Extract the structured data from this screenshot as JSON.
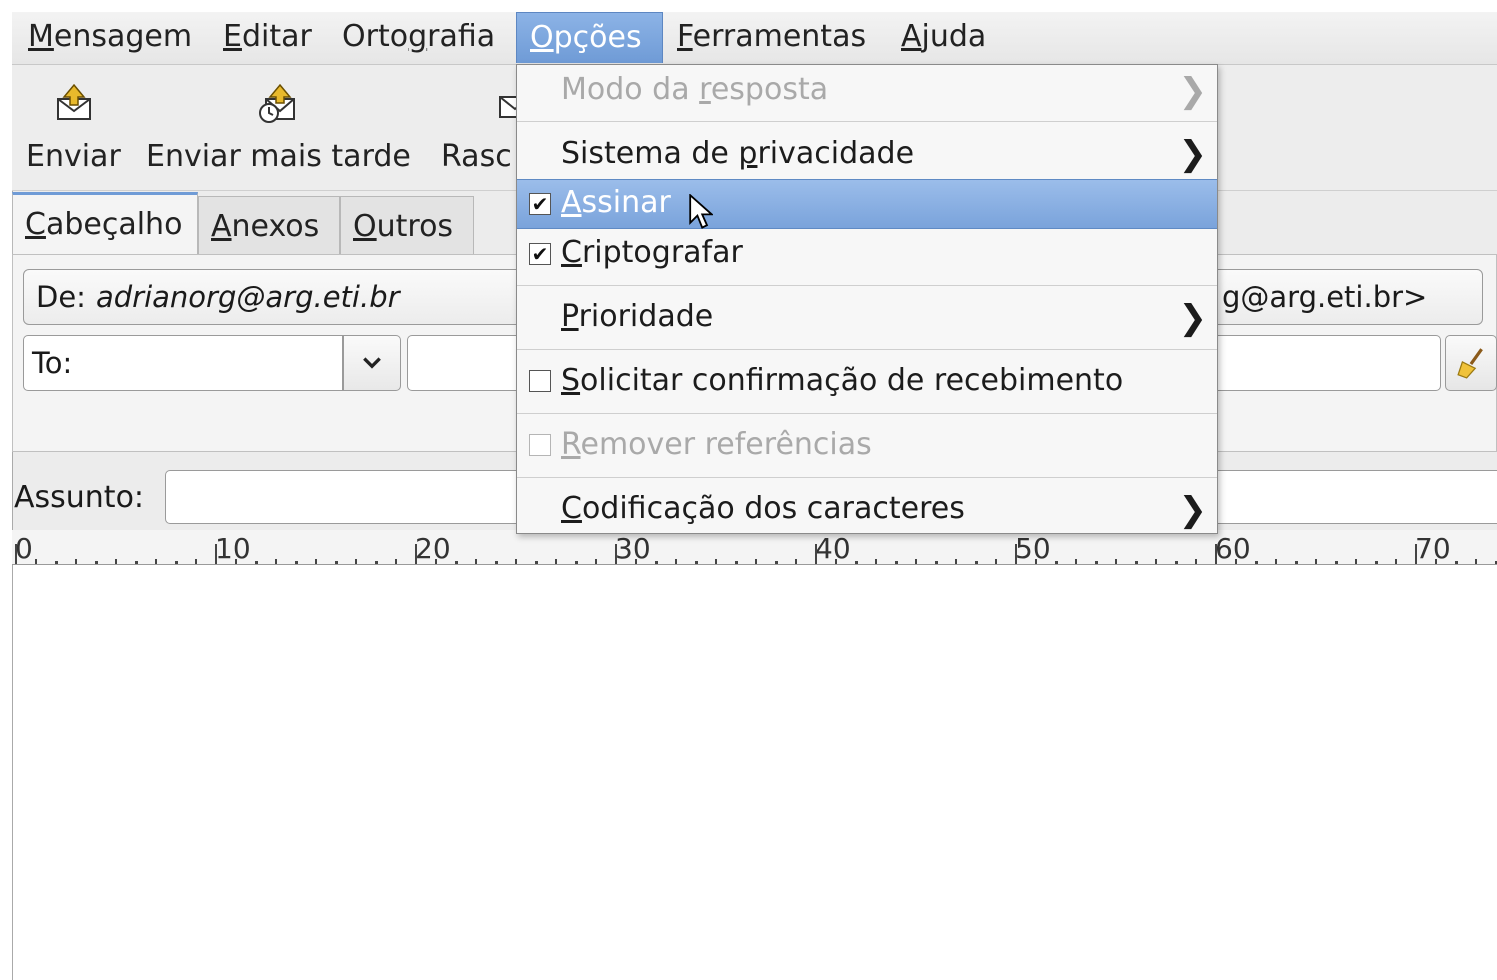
{
  "menubar": {
    "items": [
      {
        "pre": "",
        "u": "M",
        "post": "ensagem"
      },
      {
        "pre": "",
        "u": "E",
        "post": "ditar"
      },
      {
        "pre": "Orto",
        "u": "g",
        "post": "rafia"
      },
      {
        "pre": "",
        "u": "O",
        "post": "pções"
      },
      {
        "pre": "",
        "u": "F",
        "post": "erramentas"
      },
      {
        "pre": "",
        "u": "A",
        "post": "juda"
      }
    ]
  },
  "toolbar": {
    "send_label": "Enviar",
    "send_later_label": "Enviar mais tarde",
    "draft_label": "Rasc"
  },
  "tabs": [
    {
      "pre": "",
      "u": "C",
      "post": "abeçalho"
    },
    {
      "pre": "",
      "u": "A",
      "post": "nexos"
    },
    {
      "pre": "",
      "u": "O",
      "post": "utros"
    }
  ],
  "header": {
    "from_label": "De:",
    "from_value": "adrianorg@arg.eti.br",
    "from_tail": "g@arg.eti.br>",
    "to_label": "To:",
    "to_value": "",
    "subject_label": "Assunto:",
    "subject_value": ""
  },
  "ruler": {
    "labels": [
      "0",
      "10",
      "20",
      "30",
      "40",
      "50",
      "60",
      "70"
    ]
  },
  "options_menu": {
    "items": [
      {
        "pre": "Modo da ",
        "u": "r",
        "post": "esposta",
        "state": "disabled",
        "submenu": true,
        "check": null
      },
      {
        "pre": "Sistema de ",
        "u": "p",
        "post": "rivacidade",
        "state": "normal",
        "submenu": true,
        "check": null
      },
      {
        "pre": "",
        "u": "A",
        "post": "ssinar",
        "state": "highlight",
        "submenu": false,
        "check": true
      },
      {
        "pre": "",
        "u": "C",
        "post": "riptografar",
        "state": "normal",
        "submenu": false,
        "check": true
      },
      {
        "pre": "",
        "u": "P",
        "post": "rioridade",
        "state": "normal",
        "submenu": true,
        "check": null
      },
      {
        "pre": "",
        "u": "S",
        "post": "olicitar confirmação de recebimento",
        "state": "normal",
        "submenu": false,
        "check": false
      },
      {
        "pre": "",
        "u": "R",
        "post": "emover referências",
        "state": "disabled",
        "submenu": false,
        "check": false
      },
      {
        "pre": "",
        "u": "C",
        "post": "odificação dos caracteres",
        "state": "normal",
        "submenu": true,
        "check": null
      }
    ]
  }
}
